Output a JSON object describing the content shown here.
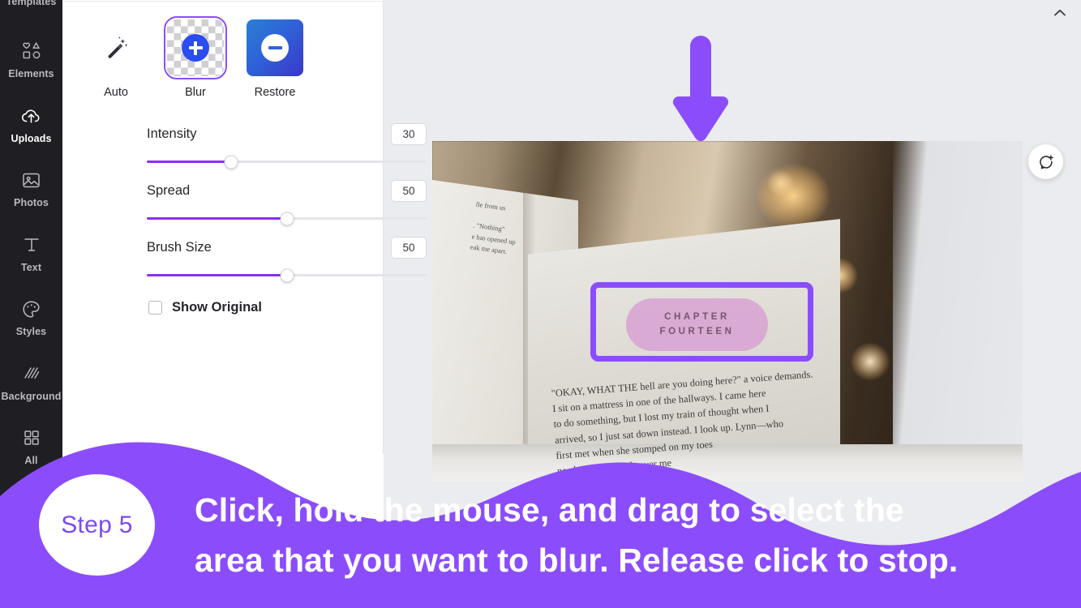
{
  "app": {
    "accent_purple": "#8b4dfc",
    "banner_purple": "#8b4dfc",
    "rail_bg": "#1f1f23",
    "slider_fill": "#8b2ff5"
  },
  "sidebar": {
    "items": [
      {
        "label": "Templates",
        "icon": "templates-icon",
        "active": false
      },
      {
        "label": "Elements",
        "icon": "shapes-icon",
        "active": false
      },
      {
        "label": "Uploads",
        "icon": "upload-cloud-icon",
        "active": true
      },
      {
        "label": "Photos",
        "icon": "image-icon",
        "active": false
      },
      {
        "label": "Text",
        "icon": "text-t-icon",
        "active": false
      },
      {
        "label": "Styles",
        "icon": "palette-icon",
        "active": false
      },
      {
        "label": "Background",
        "icon": "hatch-icon",
        "active": false
      },
      {
        "label": "All",
        "icon": "grid-icon",
        "active": false
      }
    ]
  },
  "panel": {
    "tools": [
      {
        "label": "Auto",
        "icon": "magic-wand-icon",
        "selected": false
      },
      {
        "label": "Blur",
        "icon": "blur-plus-icon",
        "selected": true
      },
      {
        "label": "Restore",
        "icon": "restore-minus-icon",
        "selected": false
      }
    ],
    "sliders": [
      {
        "label": "Intensity",
        "value": "30",
        "percent": 30
      },
      {
        "label": "Spread",
        "value": "50",
        "percent": 50
      },
      {
        "label": "Brush Size",
        "value": "50",
        "percent": 50
      }
    ],
    "show_original": {
      "label": "Show Original",
      "checked": false
    }
  },
  "stage": {
    "collapse_icon": "chevron-up-icon",
    "comment_button": "add-comment-icon",
    "arrow": "down-arrow-annotation",
    "selection": {
      "label": "blur-selection-rectangle"
    },
    "pill": {
      "line1": "CHAPTER",
      "line2": "FOURTEEN"
    },
    "book_text": {
      "left_page": "lle from us\n\n. \"Nothing\"\ne has opened up\neak me apart.",
      "right_page": "\"OKAY, WHAT THE hell are you doing here?\" a voice demands.\n  I sit on a mattress in one of the hallways. I came here\nto do something, but I lost my train of thought when I\narrived, so I just sat down instead. I look up. Lynn—who\n first met when she stomped on my toes\n ne elevator—stands over me"
    }
  },
  "banner": {
    "step_badge": "Step 5",
    "caption_line1": "Click, hold the mouse, and drag to select the",
    "caption_line2": "area that you want to blur. Release click to stop."
  }
}
